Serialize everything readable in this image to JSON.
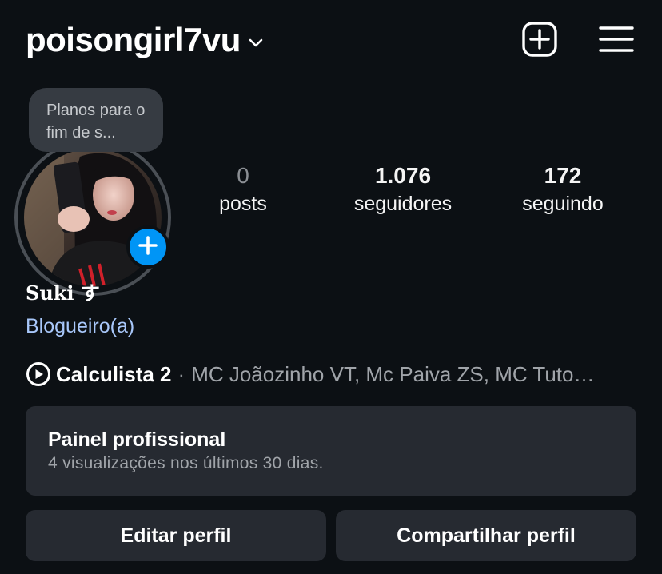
{
  "header": {
    "username": "poisongirl7vu",
    "icons": {
      "dropdown": "chevron-down-icon",
      "create": "plus-square-icon",
      "menu": "hamburger-menu-icon"
    }
  },
  "note": {
    "text": "Planos para o fim de s..."
  },
  "stats": {
    "posts": {
      "value": "0",
      "label": "posts"
    },
    "followers": {
      "value": "1.076",
      "label": "seguidores"
    },
    "following": {
      "value": "172",
      "label": "seguindo"
    }
  },
  "profile": {
    "display_name": "Suki す",
    "category": "Blogueiro(a)"
  },
  "music": {
    "icon": "play-circle-icon",
    "title": "Calculista 2",
    "separator": "·",
    "artists": "MC Joãozinho VT, Mc Paiva ZS, MC Tuto…"
  },
  "dashboard": {
    "title": "Painel profissional",
    "subtitle": "4 visualizações nos últimos 30 dias."
  },
  "buttons": {
    "edit_profile": "Editar perfil",
    "share_profile": "Compartilhar perfil"
  },
  "colors": {
    "background": "#0c1014",
    "card": "#262a31",
    "accent_blue": "#0095f6",
    "link_blue": "#a8c7fa"
  }
}
